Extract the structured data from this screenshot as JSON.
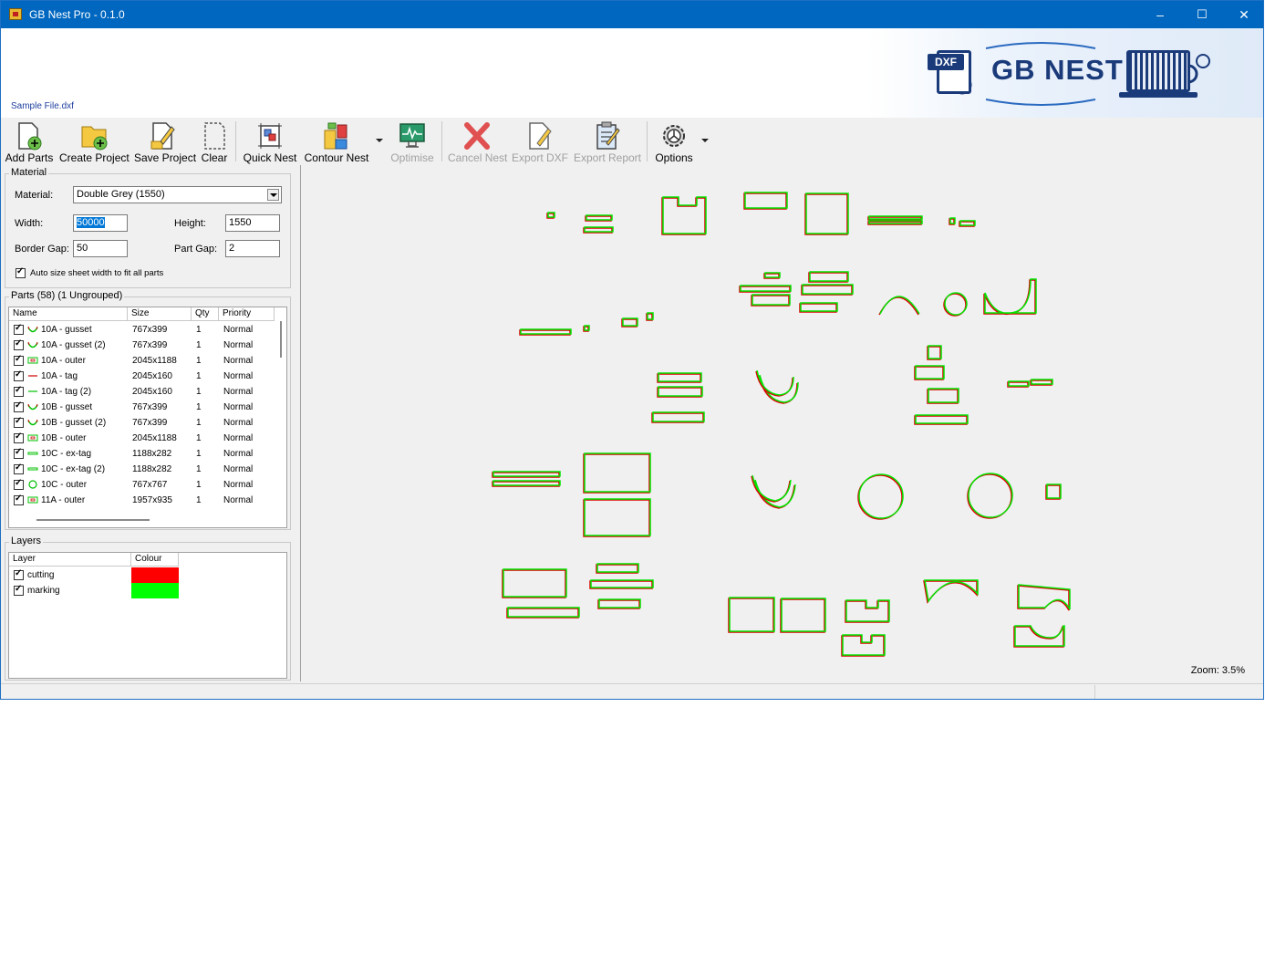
{
  "window": {
    "title": "GB Nest Pro - 0.1.0",
    "controls": {
      "minimize": "–",
      "maximize": "☐",
      "close": "✕"
    },
    "accent": "#0067c0"
  },
  "header": {
    "filename": "Sample File.dxf",
    "logo": {
      "badge": "DXF",
      "brand": "GB NEST"
    }
  },
  "toolbar": {
    "add_parts": "Add Parts",
    "create_project": "Create Project",
    "save_project": "Save Project",
    "clear": "Clear",
    "quick_nest": "Quick Nest",
    "contour_nest": "Contour Nest",
    "optimise": "Optimise",
    "cancel_nest": "Cancel Nest",
    "export_dxf": "Export DXF",
    "export_report": "Export Report",
    "options": "Options"
  },
  "material": {
    "group_title": "Material",
    "material_label": "Material:",
    "material_value": "Double Grey (1550)",
    "width_label": "Width:",
    "width_value": "50000",
    "height_label": "Height:",
    "height_value": "1550",
    "border_gap_label": "Border Gap:",
    "border_gap_value": "50",
    "part_gap_label": "Part Gap:",
    "part_gap_value": "2",
    "auto_size_label": "Auto size sheet width to fit all parts"
  },
  "parts": {
    "group_title": "Parts (58) (1 Ungrouped)",
    "columns": {
      "name": "Name",
      "size": "Size",
      "qty": "Qty",
      "priority": "Priority"
    },
    "rows": [
      {
        "name": "10A - gusset",
        "size": "767x399",
        "qty": "1",
        "priority": "Normal",
        "icon": "arc"
      },
      {
        "name": "10A - gusset (2)",
        "size": "767x399",
        "qty": "1",
        "priority": "Normal",
        "icon": "arc"
      },
      {
        "name": "10A - outer",
        "size": "2045x1188",
        "qty": "1",
        "priority": "Normal",
        "icon": "rect"
      },
      {
        "name": "10A - tag",
        "size": "2045x160",
        "qty": "1",
        "priority": "Normal",
        "icon": "line-red"
      },
      {
        "name": "10A - tag (2)",
        "size": "2045x160",
        "qty": "1",
        "priority": "Normal",
        "icon": "line"
      },
      {
        "name": "10B - gusset",
        "size": "767x399",
        "qty": "1",
        "priority": "Normal",
        "icon": "arc"
      },
      {
        "name": "10B - gusset (2)",
        "size": "767x399",
        "qty": "1",
        "priority": "Normal",
        "icon": "arc"
      },
      {
        "name": "10B - outer",
        "size": "2045x1188",
        "qty": "1",
        "priority": "Normal",
        "icon": "rect"
      },
      {
        "name": "10C - ex-tag",
        "size": "1188x282",
        "qty": "1",
        "priority": "Normal",
        "icon": "bar"
      },
      {
        "name": "10C - ex-tag (2)",
        "size": "1188x282",
        "qty": "1",
        "priority": "Normal",
        "icon": "bar"
      },
      {
        "name": "10C - outer",
        "size": "767x767",
        "qty": "1",
        "priority": "Normal",
        "icon": "circle"
      },
      {
        "name": "11A - outer",
        "size": "1957x935",
        "qty": "1",
        "priority": "Normal",
        "icon": "rect"
      }
    ]
  },
  "layers": {
    "group_title": "Layers",
    "columns": {
      "layer": "Layer",
      "colour": "Colour"
    },
    "rows": [
      {
        "name": "cutting",
        "color": "#ff0000"
      },
      {
        "name": "marking",
        "color": "#00ff00"
      }
    ]
  },
  "canvas": {
    "zoom": "Zoom: 3.5%",
    "cut_color": "#dd0000",
    "mark_color": "#00e600"
  }
}
